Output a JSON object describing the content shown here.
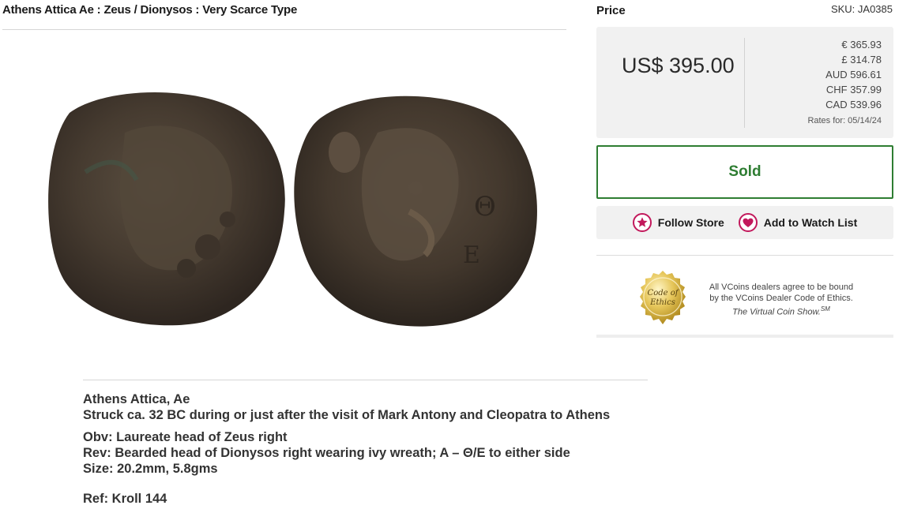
{
  "product": {
    "title": "Athens Attica Ae : Zeus / Dionysos : Very Scarce Type"
  },
  "price": {
    "label": "Price",
    "sku": "SKU: JA0385",
    "main": "US$ 395.00",
    "rates": [
      "€ 365.93",
      "£ 314.78",
      "AUD 596.61",
      "CHF 357.99",
      "CAD 539.96"
    ],
    "rates_date": "Rates for: 05/14/24"
  },
  "status": {
    "sold_label": "Sold"
  },
  "actions": {
    "follow_label": "Follow Store",
    "follow_icon": "star-icon",
    "watch_label": "Add to Watch List",
    "watch_icon": "heart-icon",
    "icon_color": "#c2185b"
  },
  "ethics": {
    "seal_text": "Code of Ethics",
    "line1": "All VCoins dealers agree to be bound",
    "line2": "by the VCoins Dealer Code of Ethics.",
    "tagline": "The Virtual Coin Show.",
    "tagline_mark": "SM"
  },
  "description": {
    "line1": "Athens Attica, Ae",
    "line2": "Struck ca. 32 BC during or just after the visit of Mark Antony and Cleopatra to Athens",
    "obverse": "Obv: Laureate head of Zeus right",
    "reverse": "Rev: Bearded head of Dionysos right wearing ivy wreath; A – Θ/E to either side",
    "size": "Size: 20.2mm, 5.8gms",
    "ref": "Ref: Kroll 144"
  },
  "colors": {
    "sold_green": "#2e7d32",
    "panel_gray": "#f1f1f1",
    "coin_bronze": "#4a3f33"
  }
}
